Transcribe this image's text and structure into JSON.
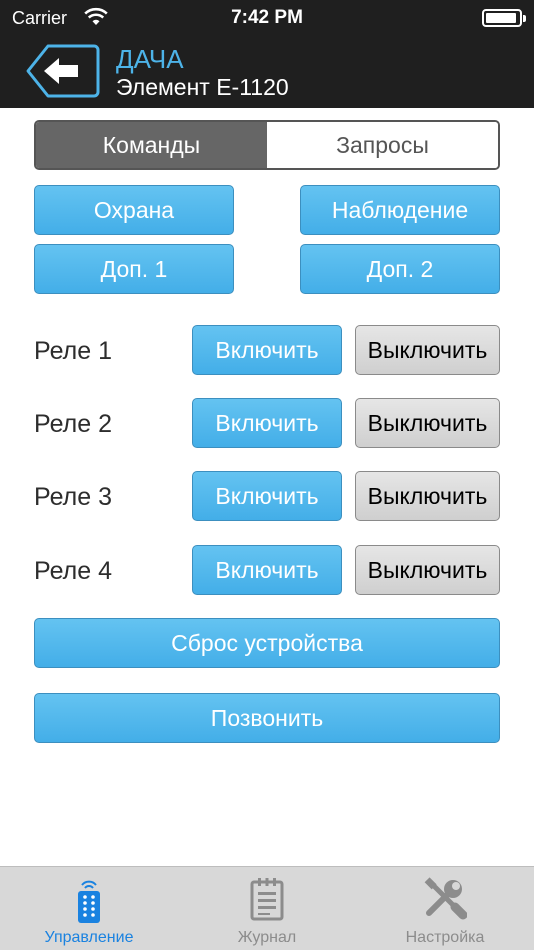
{
  "status_bar": {
    "carrier": "Carrier",
    "time": "7:42 PM"
  },
  "header": {
    "title": "ДАЧА",
    "subtitle": "Элемент Е-1120"
  },
  "segments": [
    {
      "label": "Команды",
      "active": true
    },
    {
      "label": "Запросы",
      "active": false
    }
  ],
  "buttons": {
    "guard": "Охрана",
    "observe": "Наблюдение",
    "extra1": "Доп. 1",
    "extra2": "Доп. 2",
    "reset": "Сброс устройства",
    "call": "Позвонить"
  },
  "relays": [
    {
      "label": "Реле 1",
      "on": "Включить",
      "off": "Выключить"
    },
    {
      "label": "Реле 2",
      "on": "Включить",
      "off": "Выключить"
    },
    {
      "label": "Реле 3",
      "on": "Включить",
      "off": "Выключить"
    },
    {
      "label": "Реле 4",
      "on": "Включить",
      "off": "Выключить"
    }
  ],
  "tabs": [
    {
      "label": "Управление",
      "icon": "remote-control-icon",
      "active": true
    },
    {
      "label": "Журнал",
      "icon": "notepad-icon",
      "active": false
    },
    {
      "label": "Настройка",
      "icon": "tools-icon",
      "active": false
    }
  ],
  "colors": {
    "accent_blue": "#4db3e8",
    "button_blue": "#52b8ec",
    "tab_active": "#1a82e0",
    "header_bg": "#1f1f1f"
  }
}
